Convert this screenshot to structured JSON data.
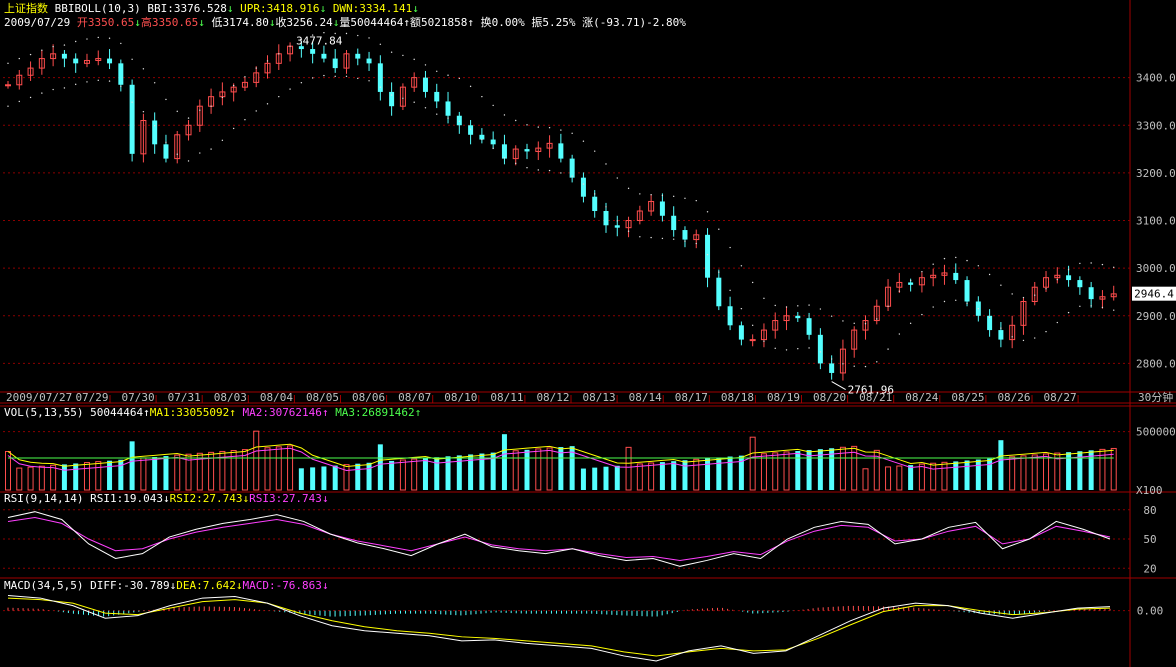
{
  "header": {
    "title": "上证指数",
    "indicator": "BBIBOLL(10,3)",
    "bbi": "BBI:3376.528",
    "upr": "UPR:3418.916",
    "dwn": "DWN:3334.141",
    "date": "2009/07/29",
    "open": "开3350.65",
    "high": "高3350.65",
    "low": "低3174.80",
    "close": "收3256.24",
    "volume": "量50044464",
    "amount": "额5021858",
    "turnover": "换0.00%",
    "amplitude": "振5.25%",
    "change": "涨(-93.71)-2.80%",
    "arrow_down": "↓",
    "arrow_up": "↑"
  },
  "vol_header": {
    "label": "VOL(5,13,55)",
    "value": "50044464",
    "ma1": "MA1:33055092",
    "ma2": "MA2:30762146",
    "ma3": "MA3:26891462"
  },
  "rsi_header": {
    "label": "RSI(9,14,14)",
    "rsi1": "RSI1:19.043",
    "rsi2": "RSI2:27.743",
    "rsi3": "RSI3:27.743"
  },
  "macd_header": {
    "label": "MACD(34,5,5)",
    "diff": "DIFF:-30.789",
    "dea": "DEA:7.642",
    "macd": "MACD:-76.863"
  },
  "colors": {
    "up": "#ff4d4d",
    "down": "#54ffff",
    "grid": "#8b0000",
    "axis_text": "#c0c0c0",
    "band_dots": "#e0e0e0",
    "rsi1": "#ffffff",
    "rsi2": "#ff40ff",
    "diff": "#ffffff",
    "dea": "#ffff00",
    "last_price_bg": "#ffffff"
  },
  "chart_data": [
    {
      "type": "candlestick",
      "panel": "price",
      "ylim": [
        2740,
        3500
      ],
      "y_ticks": [
        "3400.00",
        "3300.00",
        "3200.00",
        "3100.00",
        "3000.00",
        "2900.00",
        "2800.00"
      ],
      "y_tick_values": [
        3400,
        3300,
        3200,
        3100,
        3000,
        2900,
        2800
      ],
      "x_labels": [
        "2009/07/27",
        "07/29",
        "07/30",
        "07/31",
        "08/03",
        "08/04",
        "08/05",
        "08/06",
        "08/07",
        "08/10",
        "08/11",
        "08/12",
        "08/13",
        "08/14",
        "08/17",
        "08/18",
        "08/19",
        "08/20",
        "08/21",
        "08/24",
        "08/25",
        "08/26",
        "08/27"
      ],
      "period_label": "30分钟",
      "annotations": [
        {
          "text": "3477.84",
          "value": 3477.84
        },
        {
          "text": "2761.96",
          "value": 2761.96
        }
      ],
      "last_price": "2946.4",
      "close_path": [
        3385,
        3405,
        3420,
        3440,
        3450,
        3440,
        3430,
        3436,
        3440,
        3430,
        3385,
        3240,
        3310,
        3260,
        3230,
        3280,
        3300,
        3340,
        3360,
        3370,
        3380,
        3390,
        3410,
        3430,
        3450,
        3466,
        3460,
        3450,
        3440,
        3420,
        3450,
        3440,
        3430,
        3370,
        3340,
        3380,
        3400,
        3370,
        3350,
        3320,
        3300,
        3280,
        3270,
        3260,
        3230,
        3250,
        3245,
        3252,
        3262,
        3230,
        3190,
        3150,
        3120,
        3090,
        3085,
        3100,
        3120,
        3140,
        3110,
        3080,
        3060,
        3070,
        2980,
        2920,
        2880,
        2850,
        2850,
        2870,
        2890,
        2900,
        2895,
        2860,
        2800,
        2780,
        2830,
        2870,
        2890,
        2920,
        2960,
        2970,
        2965,
        2980,
        2985,
        2990,
        2975,
        2930,
        2900,
        2870,
        2850,
        2880,
        2930,
        2960,
        2980,
        2985,
        2975,
        2960,
        2935,
        2940,
        2946
      ]
    },
    {
      "type": "bar",
      "panel": "volume",
      "ylim": [
        0,
        600000
      ],
      "y_ticks": [
        "500000",
        "X100"
      ],
      "y_tick_values": [
        500000,
        0
      ],
      "ma_lines": [
        "MA1",
        "MA2",
        "MA3"
      ]
    },
    {
      "type": "line",
      "panel": "rsi",
      "ylim": [
        10,
        90
      ],
      "y_ticks": [
        "80",
        "50",
        "20"
      ],
      "y_tick_values": [
        80,
        50,
        20
      ],
      "series": [
        {
          "name": "RSI1",
          "values": [
            72,
            78,
            70,
            45,
            30,
            35,
            52,
            60,
            66,
            70,
            75,
            68,
            55,
            46,
            40,
            33,
            45,
            55,
            42,
            38,
            35,
            40,
            33,
            28,
            30,
            22,
            28,
            35,
            30,
            50,
            62,
            68,
            65,
            45,
            50,
            62,
            67,
            40,
            50,
            68,
            60,
            50
          ]
        },
        {
          "name": "RSI2",
          "values": [
            68,
            72,
            66,
            50,
            38,
            40,
            50,
            57,
            62,
            66,
            70,
            65,
            55,
            48,
            43,
            38,
            45,
            52,
            44,
            40,
            38,
            40,
            35,
            31,
            32,
            28,
            32,
            37,
            34,
            48,
            58,
            64,
            62,
            48,
            50,
            58,
            63,
            45,
            50,
            63,
            58,
            52
          ]
        }
      ]
    },
    {
      "type": "line",
      "panel": "macd",
      "ylim": [
        -110,
        45
      ],
      "y_ticks": [
        "0.00"
      ],
      "y_tick_values": [
        0
      ],
      "series": [
        {
          "name": "DIFF",
          "values": [
            30,
            25,
            10,
            -15,
            -10,
            10,
            25,
            28,
            15,
            -10,
            -30,
            -40,
            -45,
            -50,
            -60,
            -58,
            -65,
            -70,
            -75,
            -90,
            -100,
            -80,
            -70,
            -85,
            -80,
            -50,
            -20,
            5,
            15,
            10,
            -5,
            -15,
            -5,
            5,
            8
          ]
        },
        {
          "name": "DEA",
          "values": [
            25,
            22,
            15,
            -5,
            -8,
            5,
            18,
            22,
            15,
            -5,
            -20,
            -32,
            -40,
            -45,
            -52,
            -55,
            -60,
            -65,
            -70,
            -82,
            -90,
            -82,
            -75,
            -80,
            -78,
            -55,
            -28,
            -2,
            10,
            10,
            0,
            -8,
            -4,
            3,
            5
          ]
        }
      ]
    }
  ]
}
